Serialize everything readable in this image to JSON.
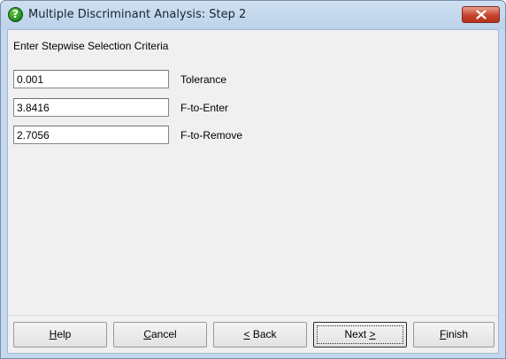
{
  "window": {
    "title": "Multiple Discriminant Analysis: Step 2",
    "title_icon": "help-question-icon",
    "close_icon": "close-icon"
  },
  "form": {
    "heading": "Enter Stepwise Selection Criteria",
    "fields": [
      {
        "value": "0.001",
        "label": "Tolerance"
      },
      {
        "value": "3.8416",
        "label": "F-to-Enter"
      },
      {
        "value": "2.7056",
        "label": "F-to-Remove"
      }
    ]
  },
  "buttons": {
    "help": {
      "mnemonic": "H",
      "rest": "elp"
    },
    "cancel": {
      "mnemonic": "C",
      "rest": "ancel"
    },
    "back": {
      "mnemonic": "<",
      "rest": " Back"
    },
    "next": {
      "text": "Next ",
      "mnemonic": ">"
    },
    "finish": {
      "mnemonic": "F",
      "rest": "inish"
    }
  },
  "colors": {
    "frame": "#c5d9ee",
    "client": "#f0f0f0",
    "close_button": "#c7432b",
    "title_icon": "#1f8a1f"
  }
}
